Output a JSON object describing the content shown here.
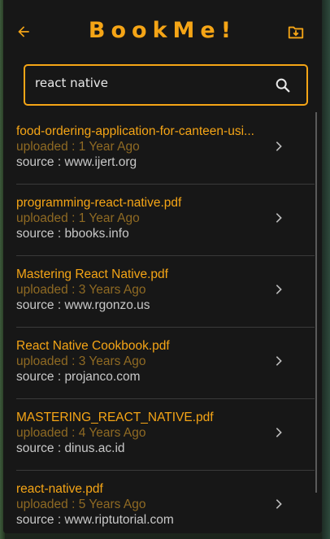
{
  "header": {
    "title": "BookMe!",
    "back_icon": "arrow-left-icon",
    "download_icon": "folder-download-icon"
  },
  "search": {
    "value": "react native",
    "icon": "search-icon"
  },
  "results": [
    {
      "name": "food-ordering-application-for-canteen-usi...",
      "uploaded": "uploaded : 1 Year Ago",
      "source": "source : www.ijert.org"
    },
    {
      "name": "programming-react-native.pdf",
      "uploaded": "uploaded : 1 Year Ago",
      "source": "source : bbooks.info"
    },
    {
      "name": "Mastering React Native.pdf",
      "uploaded": "uploaded : 3 Years Ago",
      "source": "source : www.rgonzo.us"
    },
    {
      "name": "React Native Cookbook.pdf",
      "uploaded": "uploaded : 3 Years Ago",
      "source": "source : projanco.com"
    },
    {
      "name": "MASTERING_REACT_NATIVE.pdf",
      "uploaded": "uploaded : 4 Years Ago",
      "source": "source : dinus.ac.id"
    },
    {
      "name": "react-native.pdf",
      "uploaded": "uploaded : 5 Years Ago",
      "source": "source : www.riptutorial.com"
    }
  ],
  "colors": {
    "accent": "#f5a516",
    "background": "#171717",
    "uploaded_text": "#8f6a23",
    "source_text": "#c8c8c8"
  }
}
